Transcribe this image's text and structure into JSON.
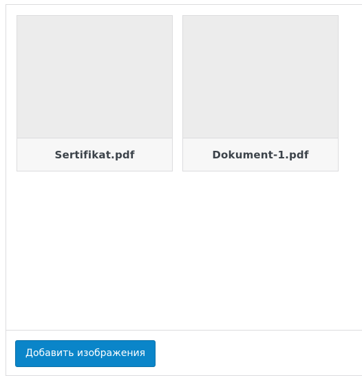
{
  "attachments": [
    {
      "filename": "Sertifikat.pdf"
    },
    {
      "filename": "Dokument-1.pdf"
    }
  ],
  "toolbar": {
    "add_images_label": "Добавить изображения"
  },
  "colors": {
    "button_blue": "#0a85c9",
    "thumbnail_gray": "#ececec",
    "border": "#dcdcde"
  }
}
